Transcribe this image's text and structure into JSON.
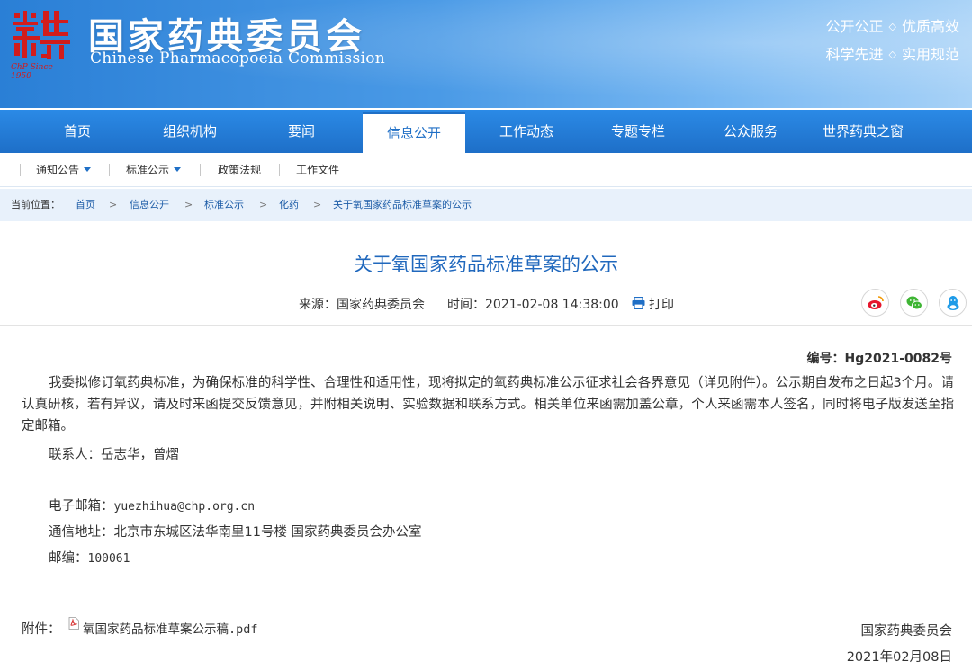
{
  "header": {
    "logo_sub": "ChP Since 1950",
    "title_cn": "国家药典委员会",
    "title_en": "Chinese Pharmacopoeia Commission",
    "slogan_1a": "公开公正",
    "slogan_1b": "优质高效",
    "slogan_2a": "科学先进",
    "slogan_2b": "实用规范",
    "slogan_dot": "◇",
    "brand_color": "#2a7fd6",
    "logo_color": "#d21c1c"
  },
  "nav": {
    "items": [
      "首页",
      "组织机构",
      "要闻",
      "信息公开",
      "工作动态",
      "专题专栏",
      "公众服务",
      "世界药典之窗"
    ],
    "active": "信息公开"
  },
  "subnav": {
    "items": [
      "通知公告",
      "标准公示",
      "政策法规",
      "工作文件"
    ]
  },
  "breadcrumb": {
    "label": "当前位置：",
    "items": [
      "首页",
      "信息公开",
      "标准公示",
      "化药",
      "关于氧国家药品标准草案的公示"
    ],
    "sep": ">"
  },
  "article": {
    "title": "关于氧国家药品标准草案的公示",
    "source": "来源：国家药典委员会",
    "time": "时间：2021-02-08 14:38:00",
    "print": "打印",
    "share_icons": [
      "weibo-icon",
      "wechat-icon",
      "qq-icon"
    ],
    "doc_no_label": "编号：",
    "doc_no": "Hg2021-0082号",
    "body": "我委拟修订氧药典标准，为确保标准的科学性、合理性和适用性，现将拟定的氧药典标准公示征求社会各界意见（详见附件）。公示期自发布之日起3个月。请认真研核，若有异议，请及时来函提交反馈意见，并附相关说明、实验数据和联系方式。相关单位来函需加盖公章，个人来函需本人签名，同时将电子版发送至指定邮箱。",
    "contact_label": "联系人：",
    "contact": "岳志华，曾熠",
    "email_label": "电子邮箱：",
    "email": "yuezhihua@chp.org.cn",
    "address_label": "通信地址：",
    "address": "北京市东城区法华南里11号楼 国家药典委员会办公室",
    "postcode_label": "邮编：",
    "postcode": "100061",
    "attachment_label": "附件：",
    "attachment": "氧国家药品标准草案公示稿.pdf",
    "sign_org": "国家药典委员会",
    "sign_date": "2021年02月08日"
  }
}
